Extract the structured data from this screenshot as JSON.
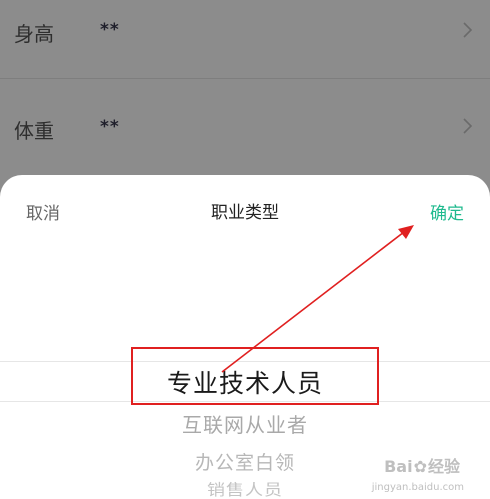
{
  "form": {
    "rows": [
      {
        "label": "身高",
        "value": "**"
      },
      {
        "label": "体重",
        "value": "**"
      }
    ]
  },
  "sheet": {
    "cancel_label": "取消",
    "title": "职业类型",
    "confirm_label": "确定",
    "picker": {
      "selected": "专业技术人员",
      "options_below": [
        "互联网从业者",
        "办公室白领",
        "销售人员"
      ]
    }
  },
  "watermark": {
    "brand_prefix": "Bai",
    "brand_suffix": "经验",
    "sub": "jingyan.baidu.com"
  },
  "colors": {
    "accent": "#1fba8e",
    "annotation": "#e02020"
  },
  "icons": {
    "row_chevron": "chevron-right-icon",
    "watermark_logo": "paw-icon"
  }
}
